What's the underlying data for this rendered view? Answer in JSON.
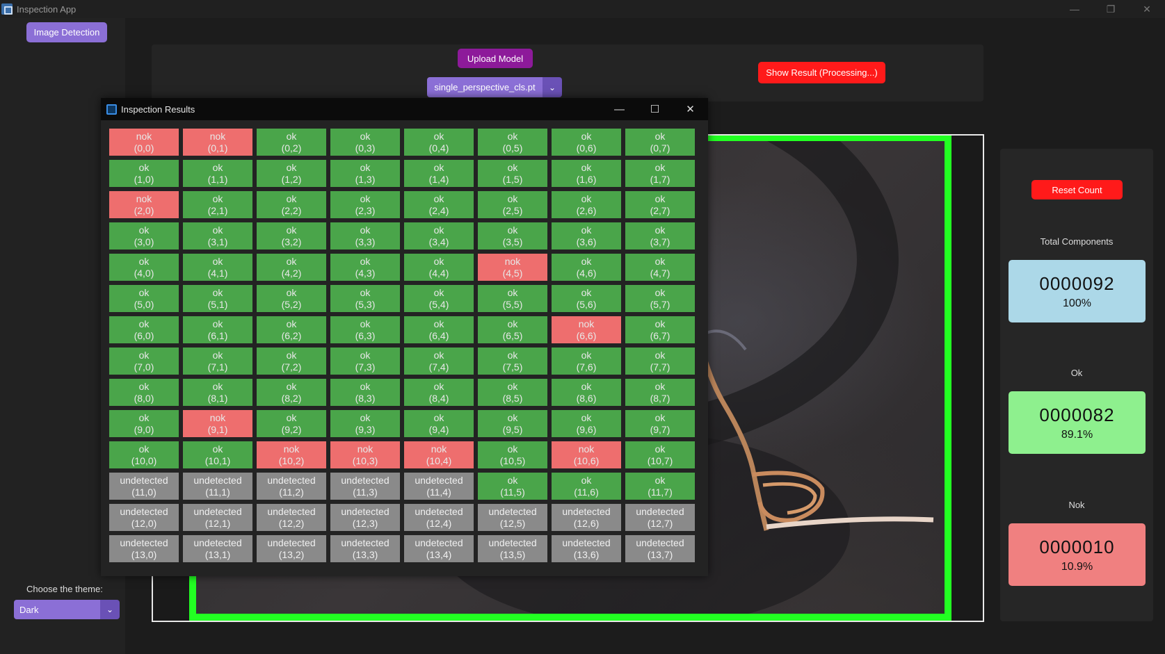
{
  "window": {
    "title": "Inspection App"
  },
  "sidebar": {
    "image_detection_label": "Image Detection",
    "theme_label": "Choose the theme:",
    "theme_value": "Dark"
  },
  "controls": {
    "upload_model_label": "Upload Model",
    "model_value": "single_perspective_cls.pt",
    "show_result_label": "Show Result (Processing...)"
  },
  "stats": {
    "reset_label": "Reset Count",
    "total": {
      "label": "Total Components",
      "count": "0000092",
      "percent": "100%"
    },
    "ok": {
      "label": "Ok",
      "count": "0000082",
      "percent": "89.1%"
    },
    "nok": {
      "label": "Nok",
      "count": "0000010",
      "percent": "10.9%"
    }
  },
  "results_window": {
    "title": "Inspection Results",
    "rows": [
      [
        "nok",
        "nok",
        "ok",
        "ok",
        "ok",
        "ok",
        "ok",
        "ok"
      ],
      [
        "ok",
        "ok",
        "ok",
        "ok",
        "ok",
        "ok",
        "ok",
        "ok"
      ],
      [
        "nok",
        "ok",
        "ok",
        "ok",
        "ok",
        "ok",
        "ok",
        "ok"
      ],
      [
        "ok",
        "ok",
        "ok",
        "ok",
        "ok",
        "ok",
        "ok",
        "ok"
      ],
      [
        "ok",
        "ok",
        "ok",
        "ok",
        "ok",
        "nok",
        "ok",
        "ok"
      ],
      [
        "ok",
        "ok",
        "ok",
        "ok",
        "ok",
        "ok",
        "ok",
        "ok"
      ],
      [
        "ok",
        "ok",
        "ok",
        "ok",
        "ok",
        "ok",
        "nok",
        "ok"
      ],
      [
        "ok",
        "ok",
        "ok",
        "ok",
        "ok",
        "ok",
        "ok",
        "ok"
      ],
      [
        "ok",
        "ok",
        "ok",
        "ok",
        "ok",
        "ok",
        "ok",
        "ok"
      ],
      [
        "ok",
        "nok",
        "ok",
        "ok",
        "ok",
        "ok",
        "ok",
        "ok"
      ],
      [
        "ok",
        "ok",
        "nok",
        "nok",
        "nok",
        "ok",
        "nok",
        "ok"
      ],
      [
        "undetected",
        "undetected",
        "undetected",
        "undetected",
        "undetected",
        "ok",
        "ok",
        "ok"
      ],
      [
        "undetected",
        "undetected",
        "undetected",
        "undetected",
        "undetected",
        "undetected",
        "undetected",
        "undetected"
      ],
      [
        "undetected",
        "undetected",
        "undetected",
        "undetected",
        "undetected",
        "undetected",
        "undetected",
        "undetected"
      ]
    ]
  },
  "colors": {
    "ok": "#4aa54a",
    "nok": "#ee6e6e",
    "undetected": "#8a8a8a",
    "accent": "#8b6fd6",
    "danger": "#ff1a1a",
    "frame": "#22ff22"
  }
}
